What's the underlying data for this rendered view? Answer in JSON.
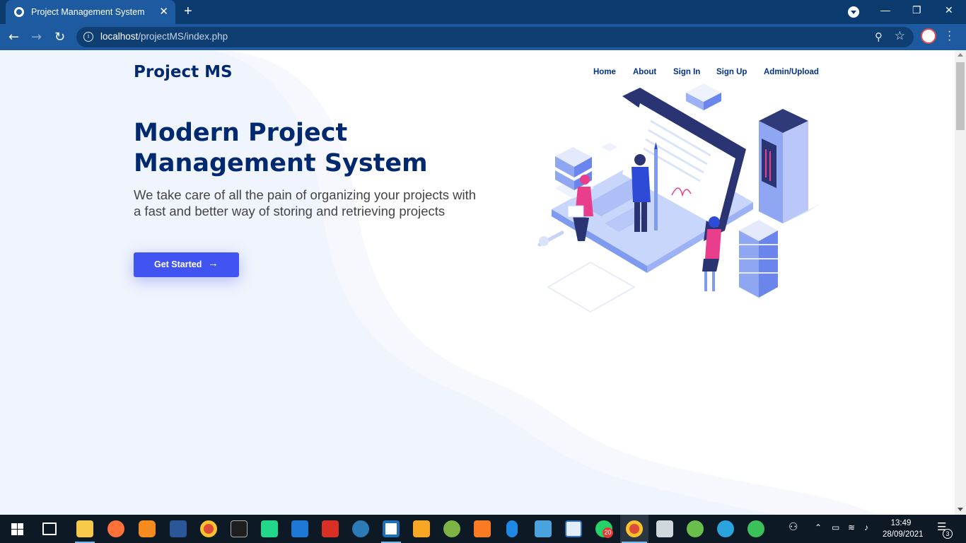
{
  "browser": {
    "tab_title": "Project Management System",
    "tab_close": "✕",
    "new_tab": "+",
    "url_host": "localhost",
    "url_path": "/projectMS/index.php",
    "window_controls": {
      "minimize": "—",
      "restore": "❐",
      "close": "✕"
    }
  },
  "site": {
    "logo": "Project MS",
    "nav": [
      "Home",
      "About",
      "Sign In",
      "Sign Up",
      "Admin/Upload"
    ],
    "hero_title": "Modern Project Management System",
    "hero_subtitle": "We take care of all the pain of organizing your projects with a fast and better way of storing and retrieving projects",
    "cta_label": "Get Started",
    "cta_arrow": "→"
  },
  "taskbar": {
    "time": "13:49",
    "date": "28/09/2021",
    "whatsapp_badge": "20",
    "notification_count": "3",
    "apps": [
      "start-icon",
      "task-view-icon",
      "file-explorer-icon",
      "firefox-icon",
      "uc-browser-icon",
      "word-icon",
      "chrome-icon",
      "terminal-icon",
      "pycharm-icon",
      "remote-app-icon",
      "sketchup-icon",
      "mu-editor-icon",
      "brackets-icon",
      "sublime-text-icon",
      "media-app-icon",
      "xampp-icon",
      "bluetooth-icon",
      "control-panel-icon",
      "window-app-icon",
      "whatsapp-icon",
      "chrome-active-icon",
      "files-icon",
      "globe-app-icon",
      "telegram-icon",
      "send-app-icon"
    ]
  },
  "colors": {
    "brand_dark": "#012970",
    "accent": "#4154f1",
    "browser_frame": "#0b3b6e",
    "page_tint": "#f0f4fd"
  }
}
